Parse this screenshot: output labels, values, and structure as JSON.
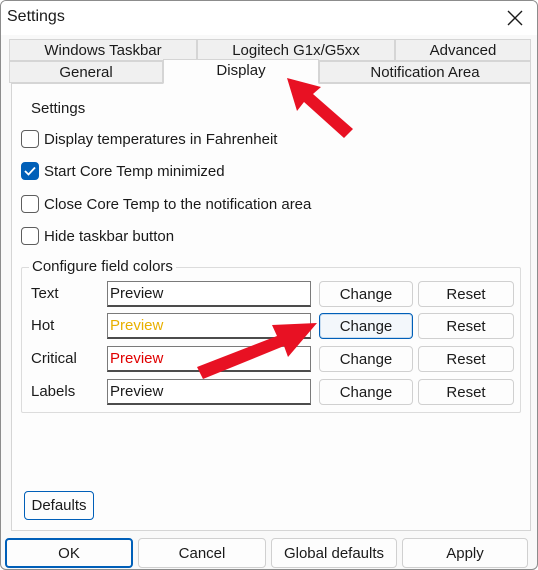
{
  "window": {
    "title": "Settings"
  },
  "tabs": {
    "row_back": [
      "Windows Taskbar",
      "Logitech G1x/G5xx",
      "Advanced"
    ],
    "row_front": [
      "General",
      "Display",
      "Notification Area"
    ],
    "active": "Display"
  },
  "settings": {
    "heading": "Settings",
    "options": [
      {
        "label": "Display temperatures in Fahrenheit",
        "checked": false
      },
      {
        "label": "Start Core Temp minimized",
        "checked": true
      },
      {
        "label": "Close Core Temp to the notification area",
        "checked": false
      },
      {
        "label": "Hide taskbar button",
        "checked": false
      }
    ]
  },
  "colors_group": {
    "legend": "Configure field colors",
    "rows": [
      {
        "label": "Text",
        "preview": "Preview",
        "color": "#1a1a1a"
      },
      {
        "label": "Hot",
        "preview": "Preview",
        "color": "#e8b000"
      },
      {
        "label": "Critical",
        "preview": "Preview",
        "color": "#e00000"
      },
      {
        "label": "Labels",
        "preview": "Preview",
        "color": "#1a1a1a"
      }
    ],
    "change_label": "Change",
    "reset_label": "Reset"
  },
  "defaults_label": "Defaults",
  "footer": {
    "ok": "OK",
    "cancel": "Cancel",
    "global_defaults": "Global defaults",
    "apply": "Apply"
  },
  "accent_color": "#005fb8",
  "annotation_color": "#e81123"
}
